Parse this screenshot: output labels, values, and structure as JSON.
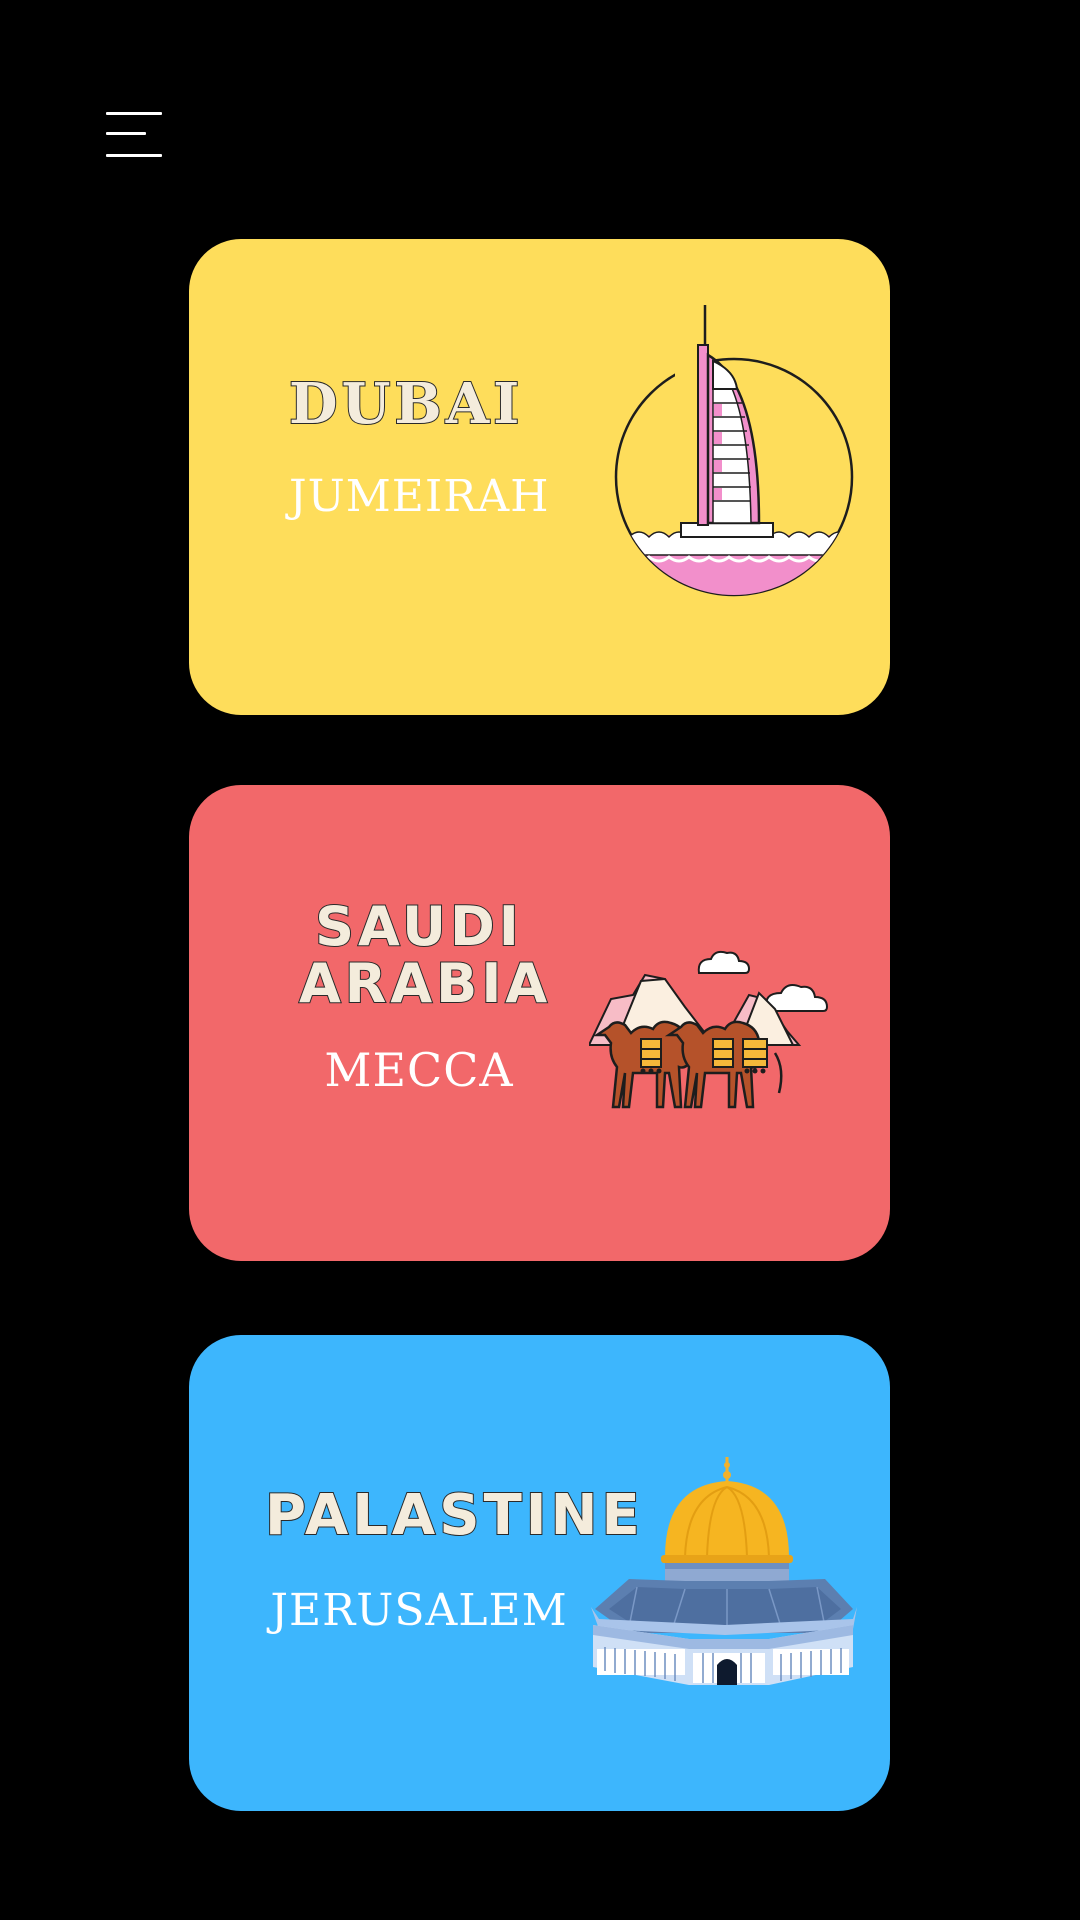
{
  "menu": {
    "icon": "hamburger-menu-icon"
  },
  "cards": [
    {
      "country": "DUBAI",
      "city": "JUMEIRAH",
      "color": "#FEDD5B",
      "illustration": "burj-al-arab-icon"
    },
    {
      "country": "SAUDI ARABIA",
      "city": "MECCA",
      "color": "#F2686A",
      "illustration": "camels-desert-icon"
    },
    {
      "country": "PALASTINE",
      "city": "JERUSALEM",
      "color": "#3DB6FD",
      "illustration": "dome-of-the-rock-icon"
    }
  ]
}
